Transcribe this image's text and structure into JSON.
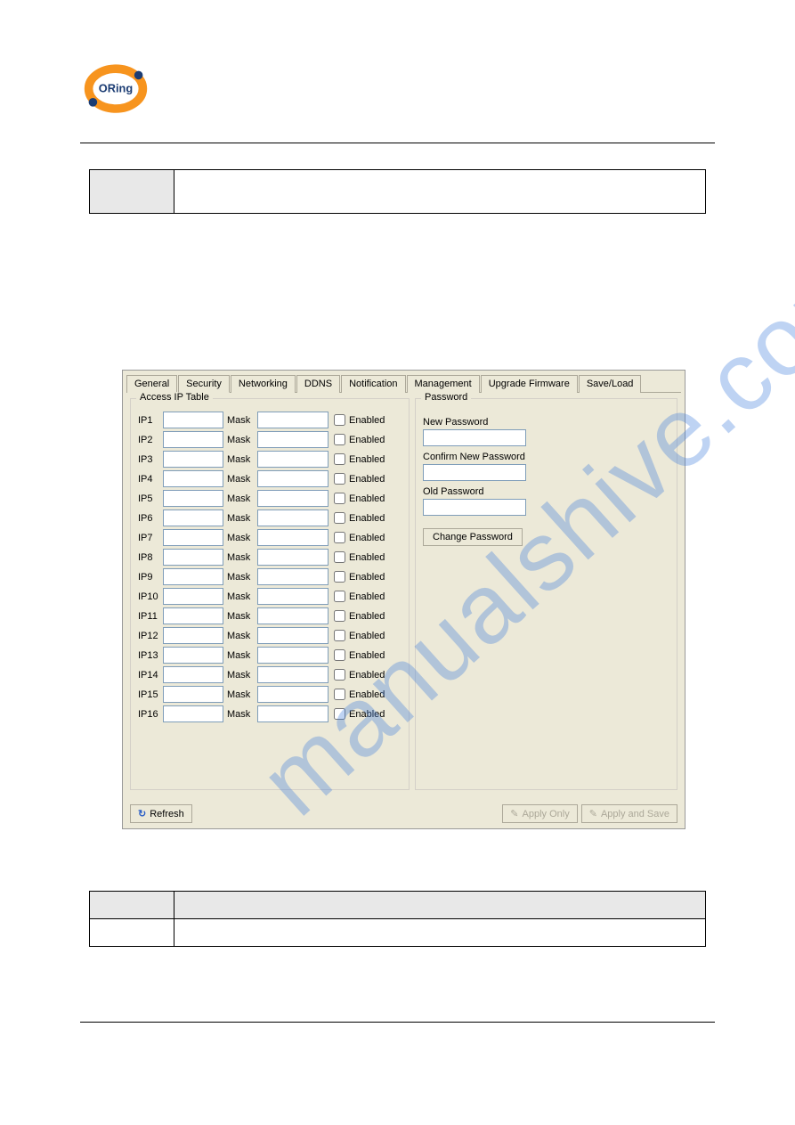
{
  "logo": {
    "text": "ORing",
    "colors": {
      "orange": "#f7941e",
      "blue": "#1b3c73"
    }
  },
  "tabs": [
    {
      "label": "General"
    },
    {
      "label": "Security"
    },
    {
      "label": "Networking"
    },
    {
      "label": "DDNS"
    },
    {
      "label": "Notification"
    },
    {
      "label": "Management"
    },
    {
      "label": "Upgrade Firmware"
    },
    {
      "label": "Save/Load"
    }
  ],
  "active_tab": "Security",
  "access_ip": {
    "title": "Access IP Table",
    "rows": [
      {
        "ip_label": "IP1",
        "ip": "",
        "mask_label": "Mask",
        "mask": "",
        "enabled_label": "Enabled",
        "enabled": false
      },
      {
        "ip_label": "IP2",
        "ip": "",
        "mask_label": "Mask",
        "mask": "",
        "enabled_label": "Enabled",
        "enabled": false
      },
      {
        "ip_label": "IP3",
        "ip": "",
        "mask_label": "Mask",
        "mask": "",
        "enabled_label": "Enabled",
        "enabled": false
      },
      {
        "ip_label": "IP4",
        "ip": "",
        "mask_label": "Mask",
        "mask": "",
        "enabled_label": "Enabled",
        "enabled": false
      },
      {
        "ip_label": "IP5",
        "ip": "",
        "mask_label": "Mask",
        "mask": "",
        "enabled_label": "Enabled",
        "enabled": false
      },
      {
        "ip_label": "IP6",
        "ip": "",
        "mask_label": "Mask",
        "mask": "",
        "enabled_label": "Enabled",
        "enabled": false
      },
      {
        "ip_label": "IP7",
        "ip": "",
        "mask_label": "Mask",
        "mask": "",
        "enabled_label": "Enabled",
        "enabled": false
      },
      {
        "ip_label": "IP8",
        "ip": "",
        "mask_label": "Mask",
        "mask": "",
        "enabled_label": "Enabled",
        "enabled": false
      },
      {
        "ip_label": "IP9",
        "ip": "",
        "mask_label": "Mask",
        "mask": "",
        "enabled_label": "Enabled",
        "enabled": false
      },
      {
        "ip_label": "IP10",
        "ip": "",
        "mask_label": "Mask",
        "mask": "",
        "enabled_label": "Enabled",
        "enabled": false
      },
      {
        "ip_label": "IP11",
        "ip": "",
        "mask_label": "Mask",
        "mask": "",
        "enabled_label": "Enabled",
        "enabled": false
      },
      {
        "ip_label": "IP12",
        "ip": "",
        "mask_label": "Mask",
        "mask": "",
        "enabled_label": "Enabled",
        "enabled": false
      },
      {
        "ip_label": "IP13",
        "ip": "",
        "mask_label": "Mask",
        "mask": "",
        "enabled_label": "Enabled",
        "enabled": false
      },
      {
        "ip_label": "IP14",
        "ip": "",
        "mask_label": "Mask",
        "mask": "",
        "enabled_label": "Enabled",
        "enabled": false
      },
      {
        "ip_label": "IP15",
        "ip": "",
        "mask_label": "Mask",
        "mask": "",
        "enabled_label": "Enabled",
        "enabled": false
      },
      {
        "ip_label": "IP16",
        "ip": "",
        "mask_label": "Mask",
        "mask": "",
        "enabled_label": "Enabled",
        "enabled": false
      }
    ]
  },
  "password": {
    "title": "Password",
    "new_label": "New Password",
    "new_value": "",
    "confirm_label": "Confirm New Password",
    "confirm_value": "",
    "old_label": "Old Password",
    "old_value": "",
    "change_button": "Change Password"
  },
  "bottom_buttons": {
    "refresh": "Refresh",
    "apply_only": "Apply Only",
    "apply_save": "Apply and Save"
  },
  "watermark_text": "manualshive.com"
}
